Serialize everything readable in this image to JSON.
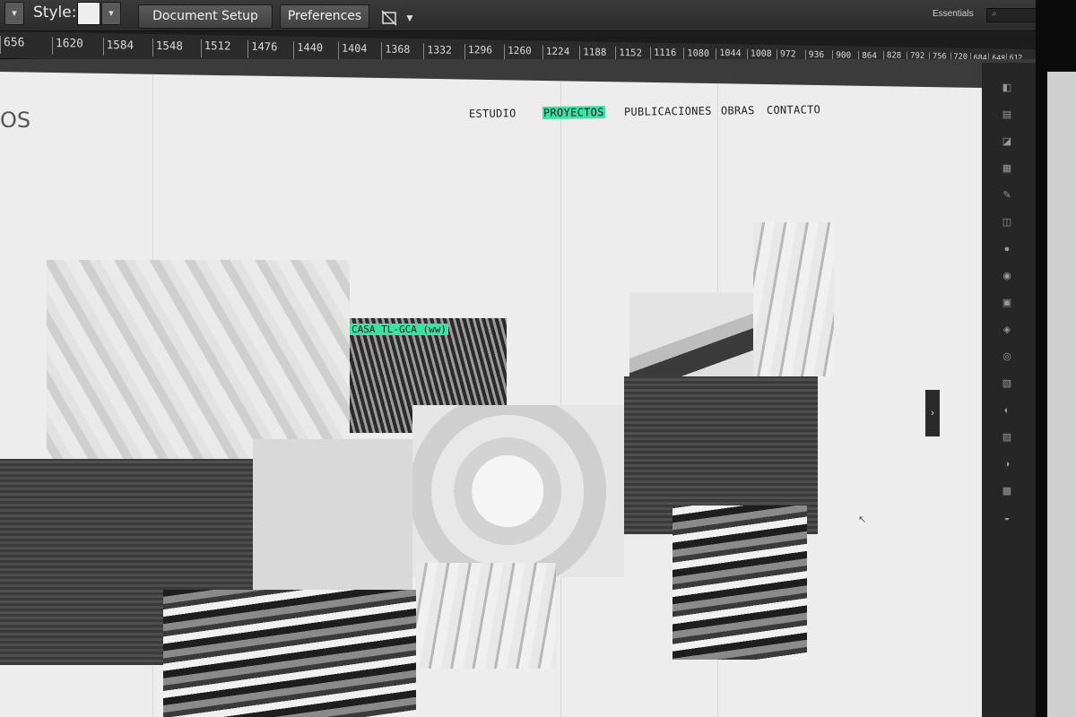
{
  "toolbar": {
    "style_label": "Style:",
    "document_setup": "Document Setup",
    "preferences": "Preferences",
    "workspace": "Essentials",
    "search_glyph": "⌕"
  },
  "ruler": [
    "656",
    "1620",
    "1584",
    "1548",
    "1512",
    "1476",
    "1440",
    "1404",
    "1368",
    "1332",
    "1296",
    "1260",
    "1224",
    "1188",
    "1152",
    "1116",
    "1080",
    "1044",
    "1008",
    "972",
    "936",
    "900",
    "864",
    "828",
    "792",
    "756",
    "720",
    "684",
    "648",
    "612"
  ],
  "page": {
    "logo_fragment": "OS",
    "nav": [
      "ESTUDIO",
      "PROYECTOS",
      "PUBLICACIONES",
      "OBRAS",
      "CONTACTO"
    ],
    "active_nav": "PROYECTOS",
    "hover_caption": "CASA TL-GCA (ww)",
    "slider_arrow": "›"
  },
  "colors": {
    "accent": "#3de0a6",
    "chrome": "#2b2b2b",
    "page_bg": "#ededed"
  },
  "icons": [
    "dropdown-arrow-icon",
    "swatch-icon",
    "screen-mode-icon",
    "search-icon",
    "tool-panel-icons"
  ]
}
